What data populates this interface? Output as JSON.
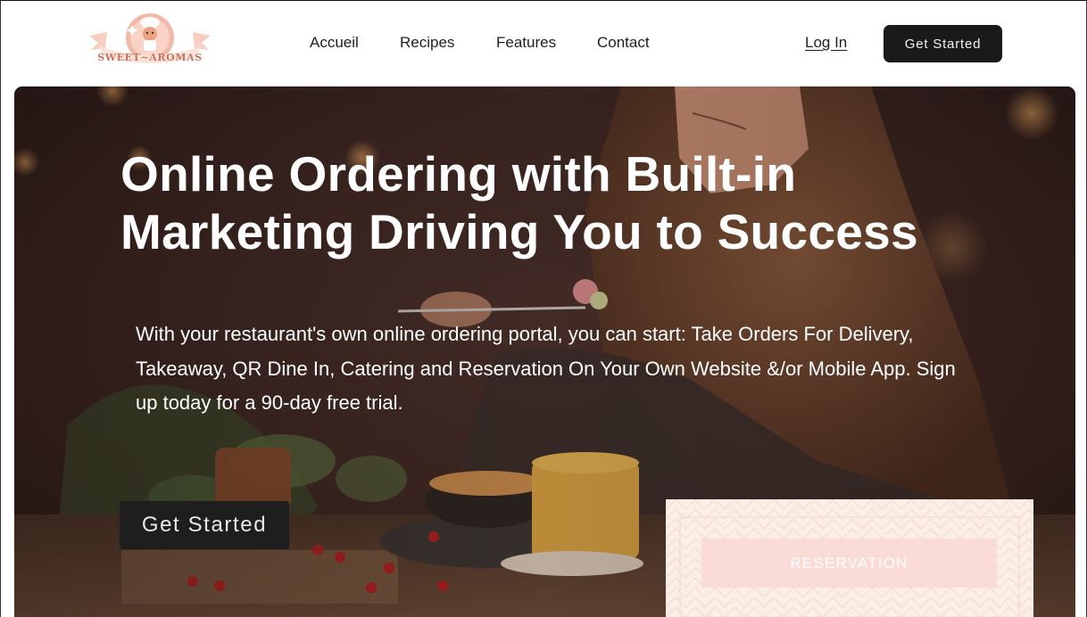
{
  "brand": {
    "logo_text": "SWEET~AROMAS"
  },
  "nav": {
    "items": [
      {
        "label": "Accueil"
      },
      {
        "label": "Recipes"
      },
      {
        "label": "Features"
      },
      {
        "label": "Contact"
      }
    ]
  },
  "header": {
    "login_label": "Log In",
    "cta_label": "Get Started"
  },
  "hero": {
    "title_line1": "Online Ordering with Built-in",
    "title_line2": "Marketing Driving You to Success",
    "description": "With your restaurant's own online ordering portal, you can start: Take Orders For Delivery, Takeaway, QR Dine In, Catering and Reservation On Your Own Website &/or Mobile App. Sign up today for a 90-day free trial.",
    "cta_label": "Get Started",
    "image_alt": "woman-eating-at-restaurant-photo"
  },
  "reservation": {
    "button_label": "RESERVATION"
  },
  "colors": {
    "dark_button": "#1a1a1a",
    "hero_overlay": "#3a2622",
    "reservation_card": "#fbeee6",
    "reservation_button": "#fadbd6",
    "logo_pink": "#f4b8a8",
    "logo_text": "#c9745f"
  }
}
